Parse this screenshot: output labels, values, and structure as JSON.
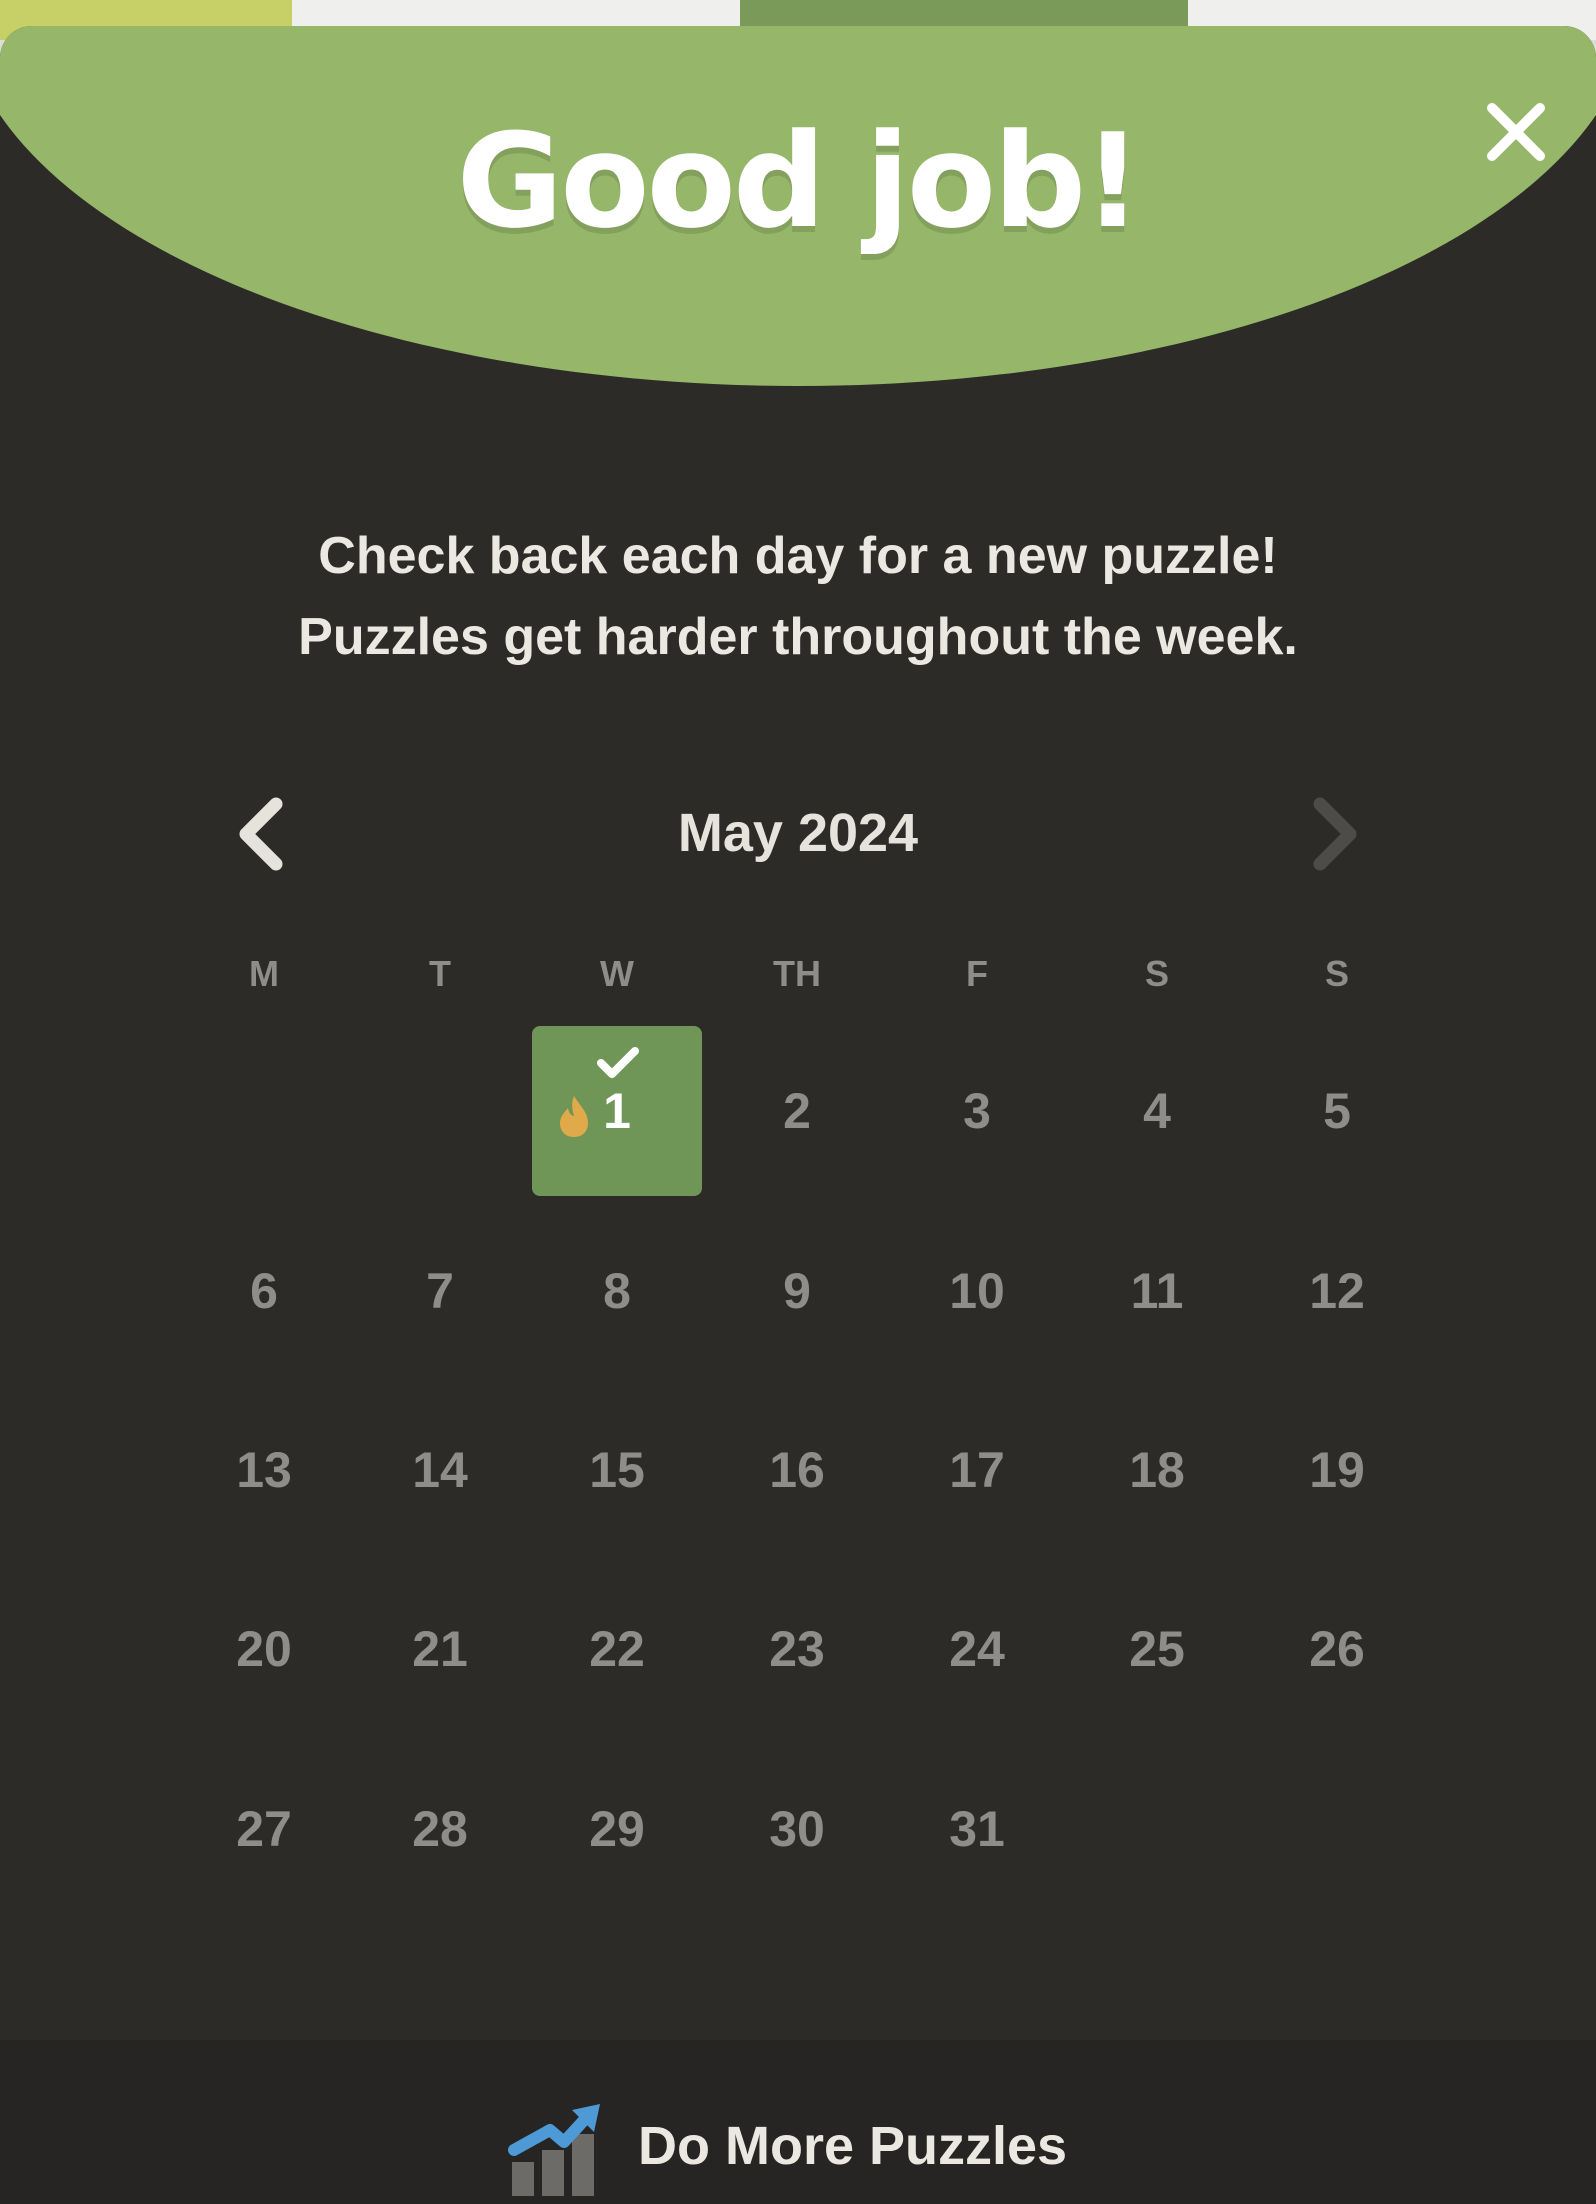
{
  "colors": {
    "banner": "#96b769",
    "modal_bg": "#2d2b28",
    "footer_bg": "#262523",
    "completed_day": "#6f9657",
    "day_text": "#8f8d89",
    "streak_flame": "#e0a94a"
  },
  "banner": {
    "title": "Good job!",
    "close_icon": "close-icon"
  },
  "message": {
    "line1": "Check back each day for a new puzzle!",
    "line2": "Puzzles get harder throughout the week."
  },
  "calendar": {
    "month_label": "May 2024",
    "prev_icon": "chevron-left-icon",
    "next_icon": "chevron-right-icon",
    "next_enabled": false,
    "weekdays": [
      "M",
      "T",
      "W",
      "TH",
      "F",
      "S",
      "S"
    ],
    "first_weekday_index": 2,
    "days": [
      "1",
      "2",
      "3",
      "4",
      "5",
      "6",
      "7",
      "8",
      "9",
      "10",
      "11",
      "12",
      "13",
      "14",
      "15",
      "16",
      "17",
      "18",
      "19",
      "20",
      "21",
      "22",
      "23",
      "24",
      "25",
      "26",
      "27",
      "28",
      "29",
      "30",
      "31"
    ],
    "completed_day": "1",
    "completed_icons": [
      "checkmark-icon",
      "flame-icon"
    ]
  },
  "footer": {
    "button_label": "Do More Puzzles",
    "button_icon": "chart-trend-up-icon"
  }
}
